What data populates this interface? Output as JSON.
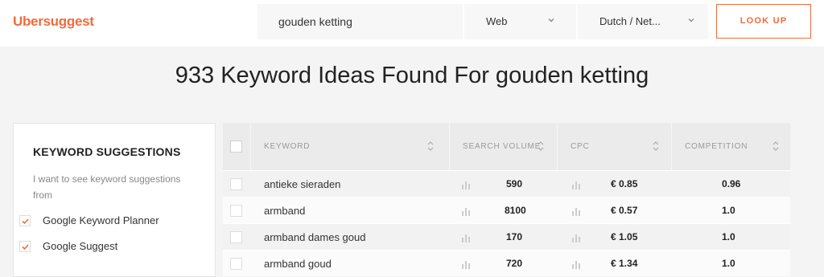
{
  "app": {
    "logo": "Ubersuggest",
    "brand_color": "#f26b3a"
  },
  "search": {
    "query": "gouden ketting",
    "source_select": "Web",
    "language_select": "Dutch / Net...",
    "lookup_label": "LOOK UP"
  },
  "heading": "933 Keyword Ideas Found For gouden ketting",
  "suggestions": {
    "title": "KEYWORD SUGGESTIONS",
    "description": "I want to see keyword suggestions from",
    "options": [
      {
        "label": "Google Keyword Planner",
        "checked": true
      },
      {
        "label": "Google Suggest",
        "checked": true
      }
    ]
  },
  "table": {
    "columns": [
      "KEYWORD",
      "SEARCH VOLUME",
      "CPC",
      "COMPETITION"
    ],
    "rows": [
      {
        "keyword": "antieke sieraden",
        "search_volume": "590",
        "cpc": "€ 0.85",
        "competition": "0.96"
      },
      {
        "keyword": "armband",
        "search_volume": "8100",
        "cpc": "€ 0.57",
        "competition": "1.0"
      },
      {
        "keyword": "armband dames goud",
        "search_volume": "170",
        "cpc": "€ 1.05",
        "competition": "1.0"
      },
      {
        "keyword": "armband goud",
        "search_volume": "720",
        "cpc": "€ 1.34",
        "competition": "1.0"
      }
    ]
  }
}
